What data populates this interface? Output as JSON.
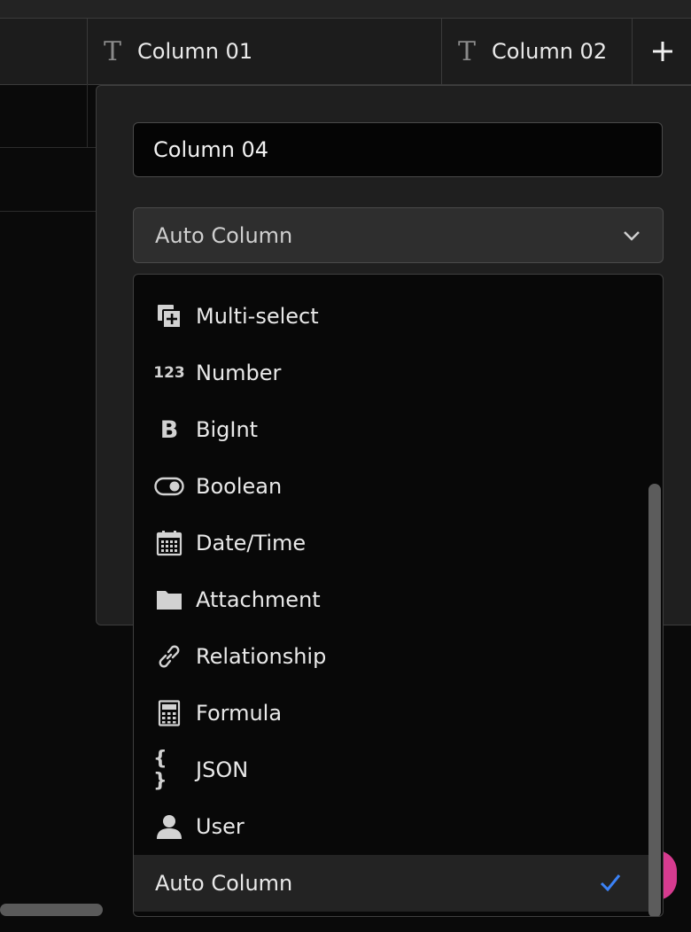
{
  "header": {
    "col1": {
      "icon": "text-type-icon",
      "label": "Column 01"
    },
    "col2": {
      "icon": "text-type-icon",
      "label": "Column 02"
    },
    "add_icon": "plus-icon"
  },
  "popover": {
    "name_input": {
      "value": "Column 04"
    },
    "type_select": {
      "value": "Auto Column",
      "icon": "chevron-down-icon"
    }
  },
  "dropdown": {
    "options": [
      {
        "label": "Multi-select",
        "icon": "multi-select-icon"
      },
      {
        "label": "Number",
        "icon": "number-icon"
      },
      {
        "label": "BigInt",
        "icon": "bigint-icon"
      },
      {
        "label": "Boolean",
        "icon": "toggle-icon"
      },
      {
        "label": "Date/Time",
        "icon": "calendar-icon"
      },
      {
        "label": "Attachment",
        "icon": "folder-icon"
      },
      {
        "label": "Relationship",
        "icon": "link-icon"
      },
      {
        "label": "Formula",
        "icon": "calculator-icon"
      },
      {
        "label": "JSON",
        "icon": "braces-icon"
      },
      {
        "label": "User",
        "icon": "user-icon"
      },
      {
        "label": "Auto Column",
        "icon": "",
        "selected": true
      }
    ],
    "number_glyph": "123",
    "bigint_glyph": "B",
    "json_glyph": "{ }",
    "check_icon": "checkmark-icon"
  },
  "colors": {
    "accent_check": "#3b82f6",
    "pink": "#d63b8f"
  }
}
